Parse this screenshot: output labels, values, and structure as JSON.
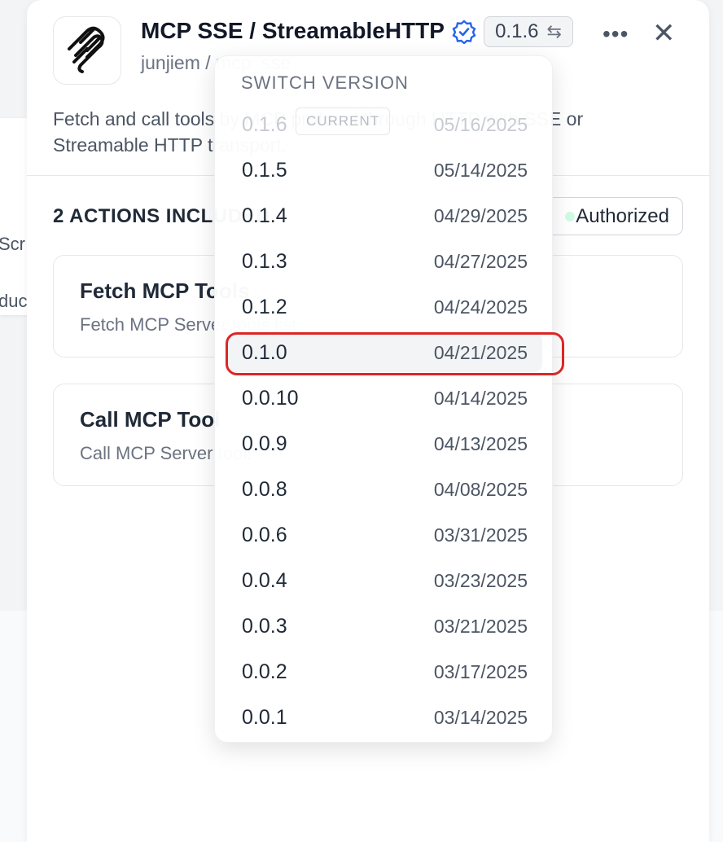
{
  "background": {
    "card_text_1": "Scr",
    "card_text_2": "duc"
  },
  "header": {
    "title": "MCP SSE / StreamableHTTP",
    "version": "0.1.6",
    "author": "junjiem / mcp_sse",
    "verified_icon": "verified-badge-icon",
    "more_icon": "more-icon",
    "close_icon": "close-icon",
    "logo_icon": "mcp-logo-icon"
  },
  "description": "Fetch and call tools by MCP protocol through HTTP with SSE or Streamable HTTP transport.",
  "actions": {
    "heading": "2 ACTIONS INCLUDED",
    "authorized_label": "Authorized",
    "items": [
      {
        "title": "Fetch MCP Tools",
        "subtitle": "Fetch MCP Server tools list."
      },
      {
        "title": "Call MCP Tool",
        "subtitle": "Call MCP Server tool."
      }
    ]
  },
  "version_dropdown": {
    "header": "SWITCH VERSION",
    "current_badge": "CURRENT",
    "versions": [
      {
        "version": "0.1.6",
        "date": "05/16/2025",
        "current": true
      },
      {
        "version": "0.1.5",
        "date": "05/14/2025"
      },
      {
        "version": "0.1.4",
        "date": "04/29/2025"
      },
      {
        "version": "0.1.3",
        "date": "04/27/2025"
      },
      {
        "version": "0.1.2",
        "date": "04/24/2025"
      },
      {
        "version": "0.1.0",
        "date": "04/21/2025",
        "highlighted": true
      },
      {
        "version": "0.0.10",
        "date": "04/14/2025"
      },
      {
        "version": "0.0.9",
        "date": "04/13/2025"
      },
      {
        "version": "0.0.8",
        "date": "04/08/2025"
      },
      {
        "version": "0.0.6",
        "date": "03/31/2025"
      },
      {
        "version": "0.0.4",
        "date": "03/23/2025"
      },
      {
        "version": "0.0.3",
        "date": "03/21/2025"
      },
      {
        "version": "0.0.2",
        "date": "03/17/2025"
      },
      {
        "version": "0.0.1",
        "date": "03/14/2025"
      }
    ]
  },
  "colors": {
    "highlight_border": "#dc2626",
    "verified_blue": "#2563eb",
    "background_accent": "#e91e8c"
  }
}
